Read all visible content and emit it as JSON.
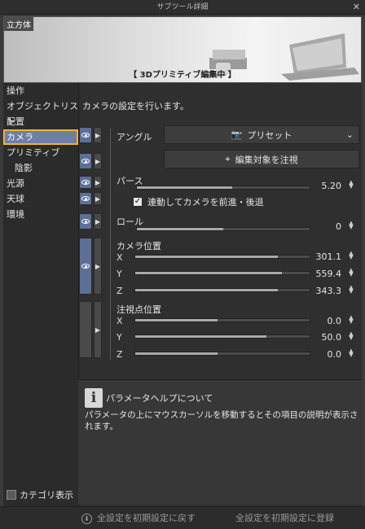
{
  "window": {
    "title": "サブツール詳細",
    "close": "✕"
  },
  "preview": {
    "tag": "立方体",
    "status": "【 3Dプリミティブ編集中 】"
  },
  "sidebar": {
    "items": [
      {
        "label": "操作"
      },
      {
        "label": "オブジェクトリスト"
      },
      {
        "label": "配置"
      },
      {
        "label": "カメラ"
      },
      {
        "label": "プリミティブ"
      },
      {
        "label": "陰影"
      },
      {
        "label": "光源"
      },
      {
        "label": "天球"
      },
      {
        "label": "環境"
      }
    ],
    "selected": "カメラ",
    "category_toggle": "カテゴリ表示"
  },
  "panel": {
    "description": "カメラの設定を行います。",
    "angle_label": "アングル",
    "preset_label": "プリセット",
    "focus_button": "編集対象を注視",
    "perspective": {
      "label": "パース",
      "value": "5.20",
      "fraction": 0.55
    },
    "dolly_checkbox": {
      "label": "連動してカメラを前進・後退",
      "checked": true
    },
    "roll": {
      "label": "ロール",
      "value": "0",
      "fraction": 0.5
    },
    "camera_position": {
      "label": "カメラ位置",
      "x": {
        "axis": "X",
        "value": "301.1",
        "fraction": 0.82
      },
      "y": {
        "axis": "Y",
        "value": "559.4",
        "fraction": 0.84
      },
      "z": {
        "axis": "Z",
        "value": "343.3",
        "fraction": 0.82
      }
    },
    "target_position": {
      "label": "注視点位置",
      "x": {
        "axis": "X",
        "value": "0.0",
        "fraction": 0.47
      },
      "y": {
        "axis": "Y",
        "value": "50.0",
        "fraction": 0.75
      },
      "z": {
        "axis": "Z",
        "value": "0.0",
        "fraction": 0.47
      }
    }
  },
  "help": {
    "title": "パラメータヘルプについて",
    "body": "パラメータの上にマウスカーソルを移動するとその項目の説明が表示されます。"
  },
  "footer": {
    "reset_label": "全設定を初期設定に戻す",
    "register_label": "全設定を初期設定に登録"
  },
  "colors": {
    "selection": "#6d7fa6",
    "highlight_outline": "#f4b331"
  }
}
